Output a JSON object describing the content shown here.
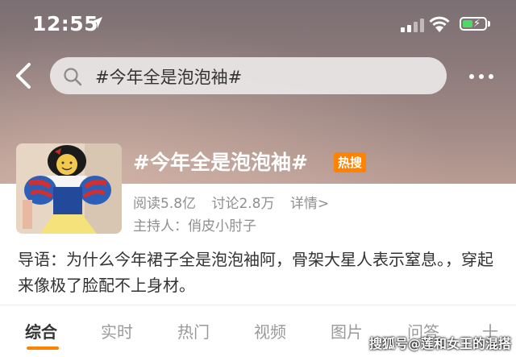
{
  "status_bar": {
    "time": "12:55"
  },
  "search": {
    "query": "#今年全是泡泡袖#"
  },
  "topic": {
    "title": "#今年全是泡泡袖#",
    "badge": "热搜",
    "reads": "阅读5.8亿",
    "discussions": "讨论2.8万",
    "details": "详情>",
    "host": "主持人：俏皮小肘子"
  },
  "intro": "导语：为什么今年裙子全是泡泡袖阿，骨架大星人表示窒息。，穿起来像极了脸配不上身材。",
  "tabs": [
    "综合",
    "实时",
    "热门",
    "视频",
    "图片",
    "问答",
    "十"
  ],
  "watermark": "搜狐号@莲和女王的混搭",
  "colors": {
    "accent": "#ff8200",
    "battery": "#4cd964"
  },
  "icons": [
    "location-arrow-icon",
    "signal-icon",
    "wifi-icon",
    "battery-icon",
    "back-icon",
    "search-icon",
    "more-icon"
  ]
}
